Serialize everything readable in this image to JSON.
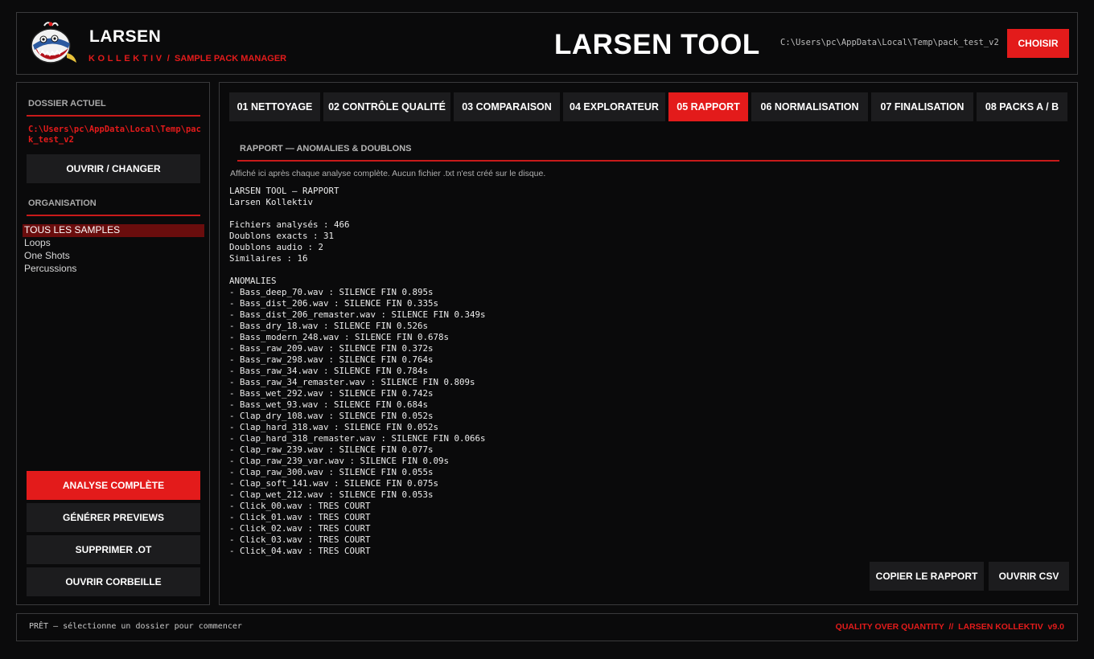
{
  "colors": {
    "accent": "#e31b1b",
    "background": "#0b0b0c",
    "panel_border": "#3a3a3c",
    "button_dark": "#1c1c1e",
    "active_item": "#6a0d0d"
  },
  "header": {
    "logo_icon": "whale-mascot-logo",
    "brand": "LARSEN",
    "brand_sub_1": "KOLLEKTIV",
    "brand_sep": "/",
    "brand_sub_2": "SAMPLE PACK MANAGER",
    "app_title": "LARSEN TOOL",
    "path": "C:\\Users\\pc\\AppData\\Local\\Temp\\pack_test_v2",
    "choose_label": "CHOISIR"
  },
  "sidebar": {
    "current_folder_title": "DOSSIER ACTUEL",
    "current_path": "C:\\Users\\pc\\AppData\\Local\\Temp\\pack_test_v2",
    "open_change_label": "OUVRIR / CHANGER",
    "organisation_title": "ORGANISATION",
    "org_items": [
      "TOUS LES SAMPLES",
      "Loops",
      "One Shots",
      "Percussions"
    ],
    "actions": {
      "full_analysis": "ANALYSE COMPLÈTE",
      "generate_previews": "GÉNÉRER PREVIEWS",
      "delete_ot": "SUPPRIMER .OT",
      "open_trash": "OUVRIR CORBEILLE"
    }
  },
  "tabs": [
    "01 NETTOYAGE",
    "02 CONTRÔLE QUALITÉ",
    "03 COMPARAISON",
    "04 EXPLORATEUR",
    "05 RAPPORT",
    "06 NORMALISATION",
    "07 FINALISATION",
    "08 PACKS A / B"
  ],
  "active_tab": "05 RAPPORT",
  "report": {
    "title": "RAPPORT — ANOMALIES & DOUBLONS",
    "hint": "Affiché ici après chaque analyse complète. Aucun fichier .txt n'est créé sur le disque.",
    "text": "LARSEN TOOL — RAPPORT\nLarsen Kollektiv\n\nFichiers analysés : 466\nDoublons exacts : 31\nDoublons audio : 2\nSimilaires : 16\n\nANOMALIES\n- Bass_deep_70.wav : SILENCE FIN 0.895s\n- Bass_dist_206.wav : SILENCE FIN 0.335s\n- Bass_dist_206_remaster.wav : SILENCE FIN 0.349s\n- Bass_dry_18.wav : SILENCE FIN 0.526s\n- Bass_modern_248.wav : SILENCE FIN 0.678s\n- Bass_raw_209.wav : SILENCE FIN 0.372s\n- Bass_raw_298.wav : SILENCE FIN 0.764s\n- Bass_raw_34.wav : SILENCE FIN 0.784s\n- Bass_raw_34_remaster.wav : SILENCE FIN 0.809s\n- Bass_wet_292.wav : SILENCE FIN 0.742s\n- Bass_wet_93.wav : SILENCE FIN 0.684s\n- Clap_dry_108.wav : SILENCE FIN 0.052s\n- Clap_hard_318.wav : SILENCE FIN 0.052s\n- Clap_hard_318_remaster.wav : SILENCE FIN 0.066s\n- Clap_raw_239.wav : SILENCE FIN 0.077s\n- Clap_raw_239_var.wav : SILENCE FIN 0.09s\n- Clap_raw_300.wav : SILENCE FIN 0.055s\n- Clap_soft_141.wav : SILENCE FIN 0.075s\n- Clap_wet_212.wav : SILENCE FIN 0.053s\n- Click_00.wav : TRES COURT\n- Click_01.wav : TRES COURT\n- Click_02.wav : TRES COURT\n- Click_03.wav : TRES COURT\n- Click_04.wav : TRES COURT",
    "copy_label": "COPIER LE RAPPORT",
    "csv_label": "OUVRIR CSV"
  },
  "footer": {
    "status": "PRÊT — sélectionne un dossier pour commencer",
    "tagline": "QUALITY OVER QUANTITY  //  LARSEN KOLLEKTIV  v9.0"
  }
}
